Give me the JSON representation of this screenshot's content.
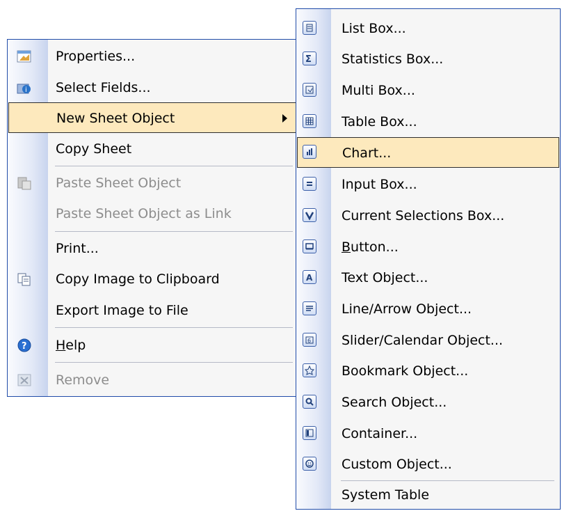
{
  "context_menu": {
    "items": [
      {
        "label": "Properties...",
        "icon": "properties-icon",
        "disabled": false
      },
      {
        "label": "Select Fields...",
        "icon": "select-fields-icon",
        "disabled": false
      },
      {
        "label": "New Sheet Object",
        "icon": "",
        "disabled": false,
        "has_submenu": true,
        "highlighted": true
      },
      {
        "label": "Copy Sheet",
        "icon": "",
        "disabled": false
      },
      {
        "label": "Paste Sheet Object",
        "icon": "paste-icon",
        "disabled": true
      },
      {
        "label": "Paste Sheet Object as Link",
        "icon": "",
        "disabled": true
      },
      {
        "label": "Print...",
        "icon": "",
        "disabled": false
      },
      {
        "label": "Copy Image to Clipboard",
        "icon": "copy-image-icon",
        "disabled": false
      },
      {
        "label": "Export Image to File",
        "icon": "",
        "disabled": false
      },
      {
        "label": "Help",
        "icon": "help-icon",
        "disabled": false,
        "mnemonic": "H"
      },
      {
        "label": "Remove",
        "icon": "remove-icon",
        "disabled": true
      }
    ]
  },
  "submenu": {
    "items": [
      {
        "label": "List Box...",
        "icon": "list-box-icon"
      },
      {
        "label": "Statistics Box...",
        "icon": "statistics-box-icon"
      },
      {
        "label": "Multi Box...",
        "icon": "multi-box-icon"
      },
      {
        "label": "Table Box...",
        "icon": "table-box-icon"
      },
      {
        "label": "Chart...",
        "icon": "chart-icon",
        "highlighted": true
      },
      {
        "label": "Input Box...",
        "icon": "input-box-icon"
      },
      {
        "label": "Current Selections Box...",
        "icon": "current-selections-icon"
      },
      {
        "label": "Button...",
        "icon": "button-icon",
        "mnemonic": "B"
      },
      {
        "label": "Text Object...",
        "icon": "text-object-icon"
      },
      {
        "label": "Line/Arrow Object...",
        "icon": "line-arrow-icon"
      },
      {
        "label": "Slider/Calendar Object...",
        "icon": "slider-calendar-icon"
      },
      {
        "label": "Bookmark Object...",
        "icon": "bookmark-icon"
      },
      {
        "label": "Search Object...",
        "icon": "search-object-icon"
      },
      {
        "label": "Container...",
        "icon": "container-icon"
      },
      {
        "label": "Custom Object...",
        "icon": "custom-object-icon"
      },
      {
        "label": "System Table",
        "icon": ""
      }
    ]
  },
  "colors": {
    "menu_border": "#1f4ba8",
    "highlight": "#fde9bd",
    "disabled_text": "#8d8d8d"
  }
}
